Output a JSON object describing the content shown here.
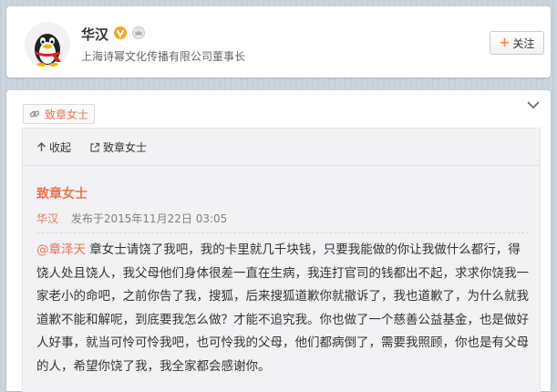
{
  "profile": {
    "name": "华汉",
    "bio": "上海诗幂文化传播有限公司董事长",
    "follow_label": "关注",
    "follow_plus": "+"
  },
  "tag": {
    "label": "致章女士"
  },
  "actions": {
    "collapse_label": "收起",
    "source_label": "致章女士"
  },
  "article": {
    "title": "致章女士",
    "author": "华汉",
    "published": "发布于2015年11月22日 03:05",
    "mention": "@章泽天",
    "body": " 章女士请饶了我吧，我的卡里就几千块钱，只要我能做的你让我做什么都行，得饶人处且饶人，我父母他们身体很差一直在生病，我连打官司的钱都出不起，求求你饶我一家老小的命吧，之前你告了我，搜狐，后来搜狐道歉你就撤诉了，我也道歉了，为什么就我道歉不能和解呢，到底要我怎么做？才能不追究我。你也做了一个慈善公益基金，也是做好人好事，就当可怜可怜我吧，也可怜我的父母，他们都病倒了，需要我照顾，你也是有父母的人，希望你饶了我，我全家都会感谢你。"
  },
  "colors": {
    "accent": "#eb7350",
    "verified": "#f5a623"
  }
}
